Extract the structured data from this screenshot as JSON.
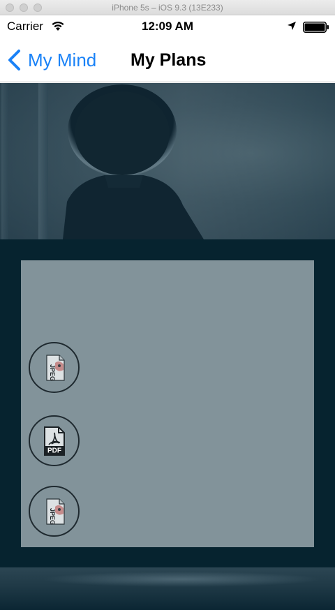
{
  "simulator": {
    "title": "iPhone 5s – iOS 9.3 (13E233)"
  },
  "status_bar": {
    "carrier": "Carrier",
    "time": "12:09 AM",
    "icons": [
      "wifi-icon",
      "location-icon",
      "battery-icon"
    ]
  },
  "nav_bar": {
    "back_label": "My Mind",
    "title": "My Plans"
  },
  "attachments": [
    {
      "type": "JPEG",
      "icon": "jpeg-file-icon"
    },
    {
      "type": "PDF",
      "icon": "pdf-file-icon"
    },
    {
      "type": "JPEG",
      "icon": "jpeg-file-icon"
    }
  ],
  "colors": {
    "accent": "#1a82f7",
    "main_background": "#06232f",
    "panel": "#82939a"
  }
}
